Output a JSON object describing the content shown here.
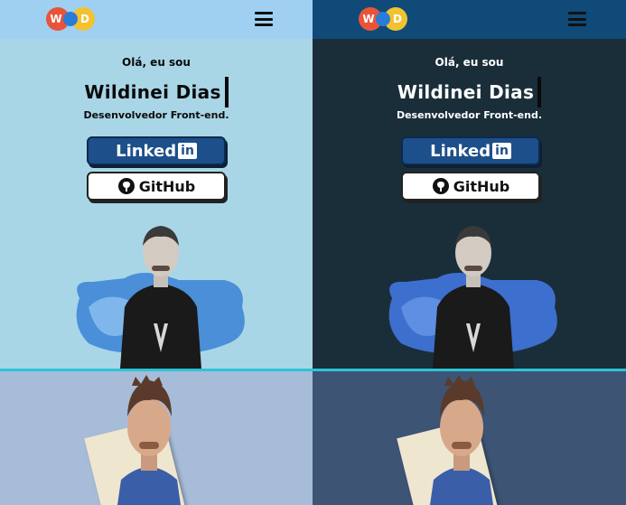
{
  "panels": {
    "light": {
      "greeting": "Olá, eu sou",
      "name": "Wildinei Dias",
      "role": "Desenvolvedor Front-end.",
      "linkedin_label": "Linked",
      "linkedin_in": "in",
      "github_label": "GitHub"
    },
    "dark": {
      "greeting": "Olá, eu sou",
      "name": "Wildinei Dias",
      "role": "Desenvolvedor Front-end.",
      "linkedin_label": "Linked",
      "linkedin_in": "in",
      "github_label": "GitHub"
    }
  },
  "logo": {
    "letters": [
      "W",
      "D"
    ]
  },
  "icons": {
    "menu": "hamburger-icon",
    "github": "github-icon"
  },
  "colors": {
    "light_bg": "#a9d6e6",
    "light_header": "#9fd0f2",
    "dark_bg": "#1a2e3a",
    "dark_header": "#0f4a78",
    "divider": "#2bc4d6",
    "linkedin_blue": "#1d4f8a"
  }
}
